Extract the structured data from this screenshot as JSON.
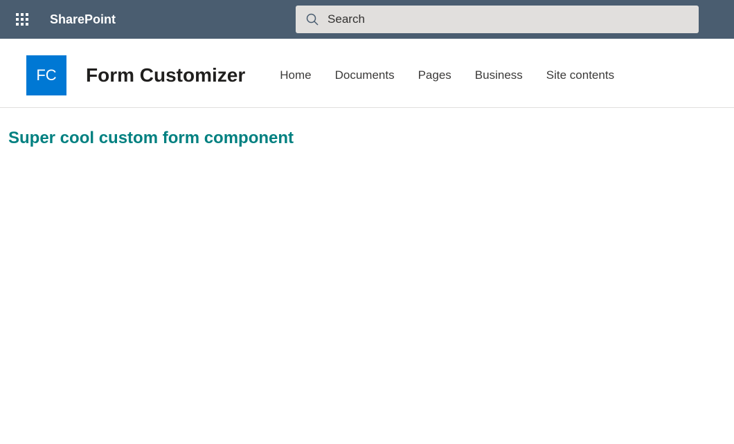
{
  "suiteBar": {
    "appName": "SharePoint",
    "search": {
      "placeholder": "Search",
      "value": ""
    }
  },
  "siteHeader": {
    "logoInitials": "FC",
    "siteName": "Form Customizer",
    "navItems": [
      {
        "label": "Home"
      },
      {
        "label": "Documents"
      },
      {
        "label": "Pages"
      },
      {
        "label": "Business"
      },
      {
        "label": "Site contents"
      }
    ]
  },
  "main": {
    "heading": "Super cool custom form component"
  },
  "colors": {
    "suiteBarBg": "#4a5d70",
    "siteLogoBg": "#0078d4",
    "headingColor": "#008080"
  }
}
